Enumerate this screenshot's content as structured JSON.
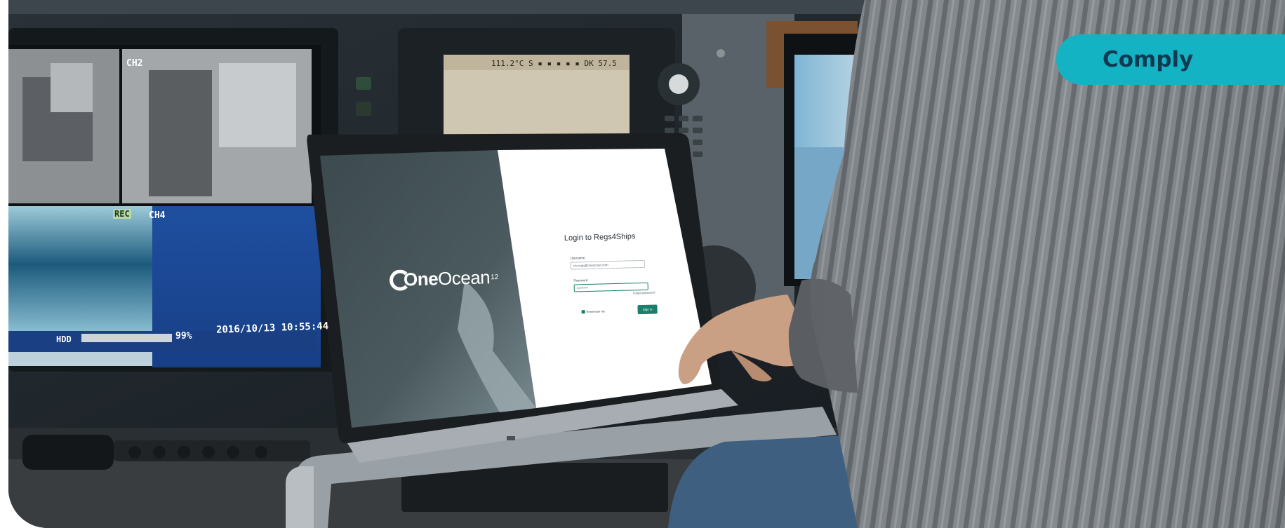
{
  "badge": {
    "label": "Comply",
    "color": "#14b3c4",
    "text_color": "#0f3a52"
  },
  "laptop_screen": {
    "logo": {
      "prefix": "One",
      "name": "Ocean",
      "sup": "12"
    },
    "login": {
      "title": "Login to Regs4Ships",
      "username_label": "Username",
      "username_value": "ch.ncap@oneocean.com",
      "password_label": "Password",
      "password_value": "••••••••••",
      "forgot_label": "Forgot password?",
      "remember_label": "Remember me",
      "signin_label": "Sign in",
      "accent": "#1a7f6e"
    }
  },
  "cctv_monitor": {
    "ch2": "CH2",
    "ch4": "CH4",
    "rec": "REC",
    "hdd_label": "HDD",
    "hdd_percent": "99%",
    "hdd_fill": 0.99,
    "timestamp": "2016/10/13 10:55:44"
  },
  "radar_display": {
    "readout": "111.2°C S ▪ ▪ ▪ ▪ ▪ DK 57.5"
  }
}
